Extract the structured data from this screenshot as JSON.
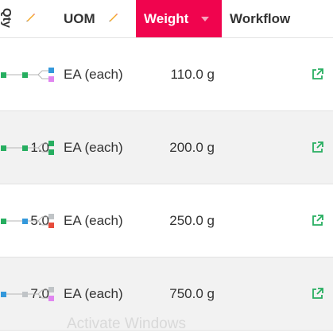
{
  "header": {
    "qty_label": "Qty",
    "uom_label": "UOM",
    "weight_label": "Weight",
    "workflow_label": "Workflow"
  },
  "rows": [
    {
      "qty": "",
      "uom": "EA (each)",
      "weight": "110.0 g",
      "workflow_colors": [
        "#27ae60",
        "#27ae60",
        "#3498db",
        "#e085f0"
      ]
    },
    {
      "qty": "1.0",
      "uom": "EA (each)",
      "weight": "200.0 g",
      "workflow_colors": [
        "#27ae60",
        "#27ae60",
        "#27ae60",
        "#27ae60"
      ]
    },
    {
      "qty": "5.0",
      "uom": "EA (each)",
      "weight": "250.0 g",
      "workflow_colors": [
        "#27ae60",
        "#3498db",
        "#c0c4c7",
        "#e74c3c"
      ]
    },
    {
      "qty": "7.0",
      "uom": "EA (each)",
      "weight": "750.0 g",
      "workflow_colors": [
        "#3498db",
        "#c0c4c7",
        "#c0c4c7",
        "#e085f0"
      ]
    }
  ],
  "watermark": "Activate Windows",
  "colors": {
    "accent": "#f0044e",
    "link": "#27ae60",
    "pencil": "#f5a623"
  }
}
